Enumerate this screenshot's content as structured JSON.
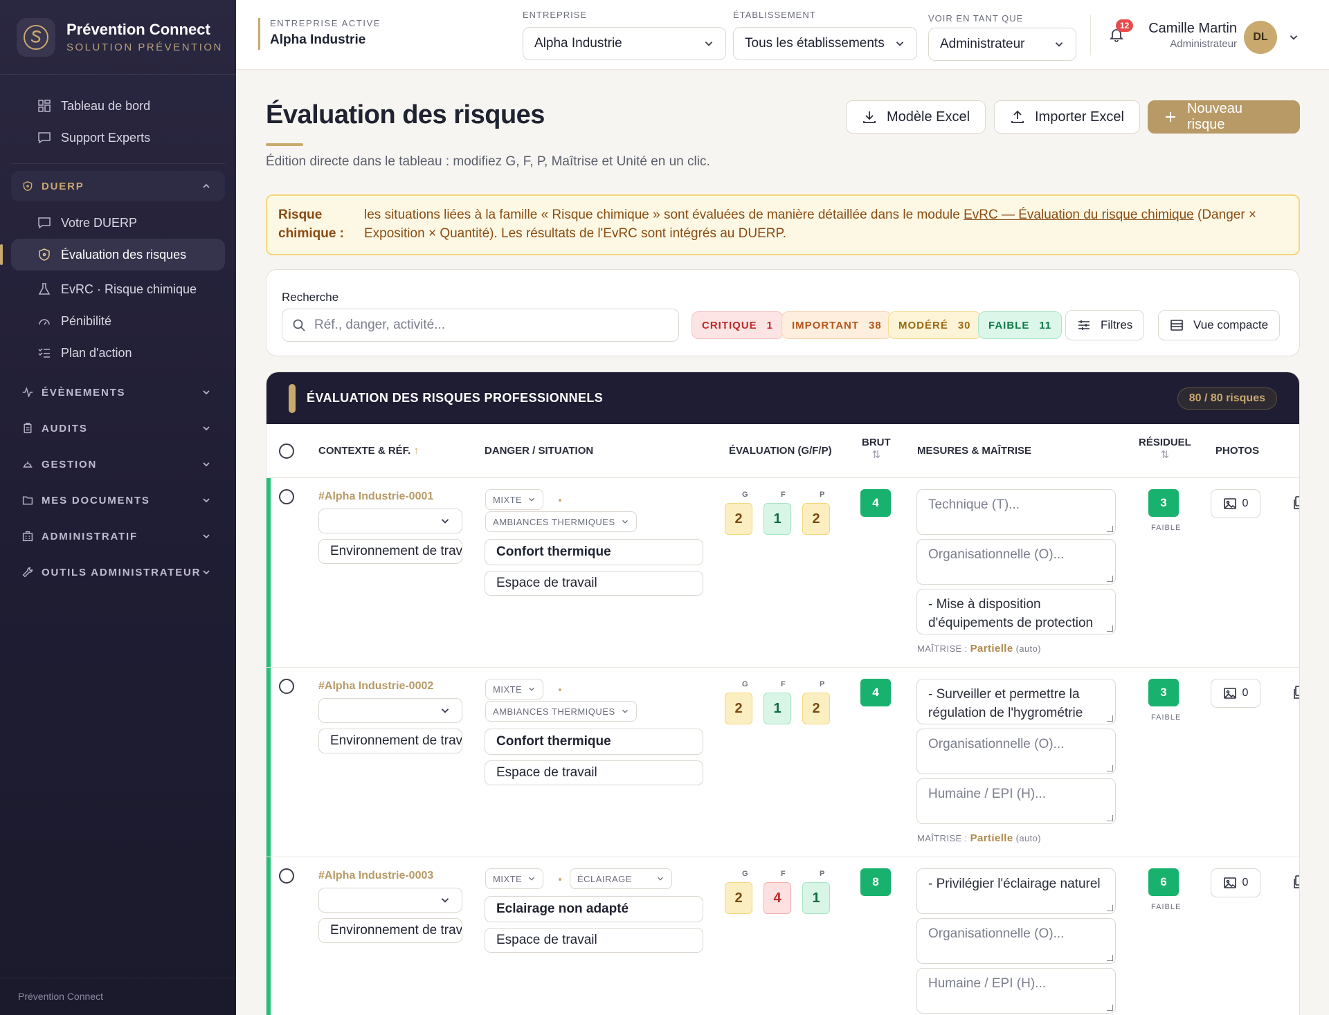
{
  "brand": {
    "name": "Prévention Connect",
    "subtitle": "SOLUTION PRÉVENTION"
  },
  "sidebar": {
    "top_items": [
      {
        "label": "Tableau de bord",
        "icon": "dashboard-icon"
      },
      {
        "label": "Support Experts",
        "icon": "chat-icon"
      }
    ],
    "duerp_section": "DUERP",
    "duerp_items": [
      {
        "label": "Votre DUERP",
        "icon": "chat-icon"
      },
      {
        "label": "Évaluation des risques",
        "icon": "shield-icon",
        "active": true
      },
      {
        "label": "EvRC · Risque chimique",
        "icon": "flask-icon"
      },
      {
        "label": "Pénibilité",
        "icon": "gauge-icon"
      },
      {
        "label": "Plan d'action",
        "icon": "checklist-icon"
      }
    ],
    "sections": [
      {
        "label": "ÉVÈNEMENTS",
        "icon": "activity-icon"
      },
      {
        "label": "AUDITS",
        "icon": "clipboard-icon"
      },
      {
        "label": "GESTION",
        "icon": "helmet-icon"
      },
      {
        "label": "MES DOCUMENTS",
        "icon": "folder-icon"
      },
      {
        "label": "ADMINISTRATIF",
        "icon": "building-icon"
      },
      {
        "label": "OUTILS ADMINISTRATEUR",
        "icon": "wrench-icon"
      }
    ],
    "footer": "Prévention Connect"
  },
  "topbar": {
    "active_company_label": "ENTREPRISE ACTIVE",
    "active_company": "Alpha Industrie",
    "entreprise_label": "ENTREPRISE",
    "entreprise_value": "Alpha Industrie",
    "etablissement_label": "ÉTABLISSEMENT",
    "etablissement_value": "Tous les établissements",
    "voir_label": "VOIR EN TANT QUE",
    "voir_value": "Administrateur",
    "notifications": "12",
    "user_name": "Camille Martin",
    "user_role": "Administrateur",
    "avatar_initials": "DL"
  },
  "page": {
    "title": "Évaluation des risques",
    "subtitle": "Édition directe dans le tableau : modifiez G, F, P, Maîtrise et Unité en un clic.",
    "btn_model": "Modèle Excel",
    "btn_import": "Importer Excel",
    "btn_new": "Nouveau risque"
  },
  "alert": {
    "title": "Risque chimique :",
    "text_before": "les situations liées à la famille « Risque chimique » sont évaluées de manière détaillée dans le module ",
    "link": "EvRC — Évaluation du risque chimique",
    "text_after": " (Danger × Exposition × Quantité). Les résultats de l'EvRC sont intégrés au DUERP."
  },
  "filters": {
    "search_label": "Recherche",
    "search_placeholder": "Réf., danger, activité...",
    "chips": [
      {
        "label": "CRITIQUE",
        "count": "1",
        "bg": "#fde4e4",
        "border": "#f6c0c0",
        "color": "#c0282a"
      },
      {
        "label": "IMPORTANT",
        "count": "38",
        "bg": "#fdeedd",
        "border": "#f6d3ad",
        "color": "#b4561c"
      },
      {
        "label": "MODÉRÉ",
        "count": "30",
        "bg": "#fdf3d6",
        "border": "#f3dc94",
        "color": "#9a6a10"
      },
      {
        "label": "FAIBLE",
        "count": "11",
        "bg": "#dcf6e9",
        "border": "#ace6c9",
        "color": "#0f7a48"
      }
    ],
    "btn_filters": "Filtres",
    "btn_compact": "Vue compacte"
  },
  "table": {
    "title": "ÉVALUATION DES RISQUES PROFESSIONNELS",
    "count": "80 / 80 risques",
    "columns": {
      "context": "CONTEXTE & RÉF.",
      "danger": "DANGER / SITUATION",
      "eval": "ÉVALUATION (G/F/P)",
      "brut": "BRUT",
      "mesures": "MESURES & MAÎTRISE",
      "residuel": "RÉSIDUEL",
      "photos": "PHOTOS"
    },
    "gfp_labels": [
      "G",
      "F",
      "P"
    ],
    "maitrise_label": "MAÎTRISE :",
    "maitrise_auto": "(auto)",
    "rows": [
      {
        "ref": "#Alpha Industrie-0001",
        "unit": "",
        "context": "Environnement de travail",
        "type": "MIXTE",
        "family": "AMBIANCES THERMIQUES",
        "danger": "Confort thermique",
        "situation": "Espace de travail",
        "g": "2",
        "f": "1",
        "p": "2",
        "brut": "4",
        "tech": "",
        "tech_ph": "Technique (T)...",
        "org": "",
        "org_ph": "Organisationnelle (O)...",
        "hum": "- Mise à disposition d'équipements de protection",
        "hum_ph": "Humaine / EPI (H)...",
        "maitrise": "Partielle",
        "residuel": "3",
        "residuel_level": "FAIBLE",
        "photos": "0"
      },
      {
        "ref": "#Alpha Industrie-0002",
        "unit": "",
        "context": "Environnement de travail",
        "type": "MIXTE",
        "family": "AMBIANCES THERMIQUES",
        "danger": "Confort thermique",
        "situation": "Espace de travail",
        "g": "2",
        "f": "1",
        "p": "2",
        "brut": "4",
        "tech": "- Surveiller et permettre la régulation de l'hygrométrie",
        "tech_ph": "Technique (T)...",
        "org": "",
        "org_ph": "Organisationnelle (O)...",
        "hum": "",
        "hum_ph": "Humaine / EPI (H)...",
        "maitrise": "Partielle",
        "residuel": "3",
        "residuel_level": "FAIBLE",
        "photos": "0"
      },
      {
        "ref": "#Alpha Industrie-0003",
        "unit": "",
        "context": "Environnement de travail",
        "type": "MIXTE",
        "family": "ÉCLAIRAGE",
        "danger": "Eclairage non adapté",
        "situation": "Espace de travail",
        "g": "2",
        "f": "4",
        "p": "1",
        "brut": "8",
        "tech": "- Privilégier l'éclairage naturel",
        "tech_ph": "Technique (T)...",
        "org": "",
        "org_ph": "Organisationnelle (O)...",
        "hum": "",
        "hum_ph": "Humaine / EPI (H)...",
        "maitrise": "",
        "residuel": "6",
        "residuel_level": "FAIBLE",
        "photos": "0"
      }
    ]
  }
}
